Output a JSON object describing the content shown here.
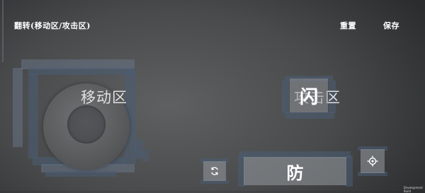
{
  "header": {
    "flip_label": "翻转(移动区/攻击区)",
    "reset_label": "重置",
    "save_label": "保存"
  },
  "zones": {
    "move_label": "移动区",
    "attack_label": "攻击区"
  },
  "actions": {
    "dodge_label": "闪",
    "defend_label": "防",
    "swap_icon": "refresh-icon",
    "target_icon": "crosshair-icon"
  },
  "footer": {
    "dev_build": "Development Build"
  },
  "colors": {
    "zone_frame": "#4a5c74",
    "button_fill": "#96999f",
    "background": "#494a4b"
  }
}
